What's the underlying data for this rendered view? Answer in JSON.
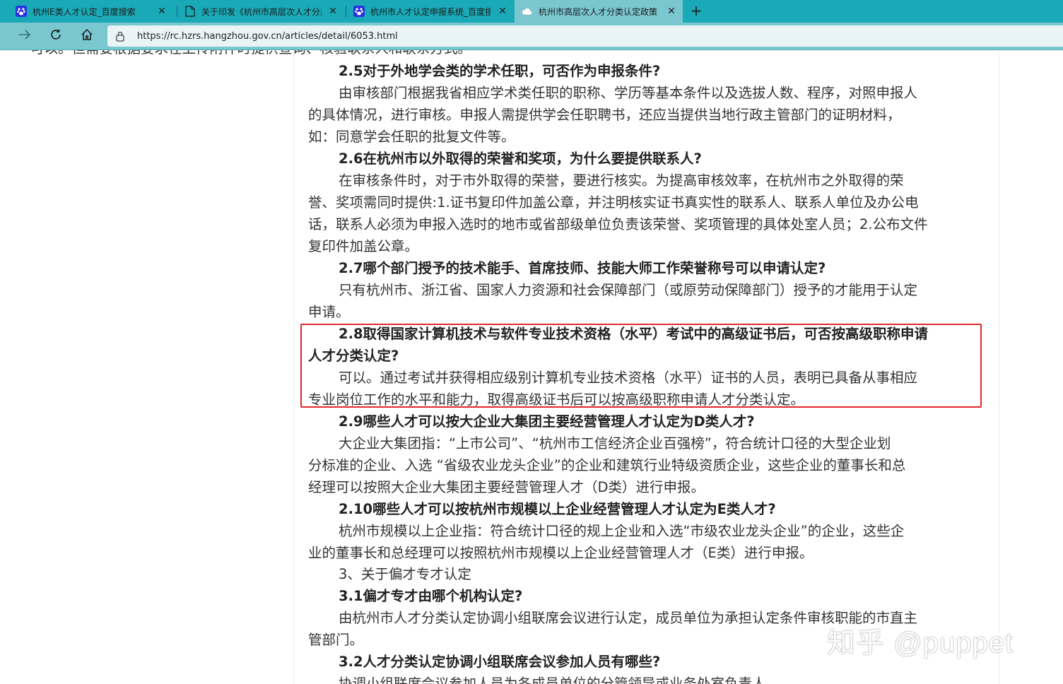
{
  "browser": {
    "tabs": [
      {
        "title": "杭州E类人才认定_百度搜索",
        "icon": "baidu-paw-icon",
        "active": false
      },
      {
        "title": "关于印发《杭州市高层次人才分类",
        "icon": "document-icon",
        "active": false
      },
      {
        "title": "杭州市人才认定申报系统_百度搜",
        "icon": "baidu-paw-icon",
        "active": false
      },
      {
        "title": "杭州市高层次人才分类认定政策",
        "icon": "loading-cloud-icon",
        "active": true
      }
    ],
    "close_glyph": "✕",
    "new_tab_glyph": "+",
    "url": "https://rc.hzrs.hangzhou.gov.cn/articles/detail/6053.html",
    "colors": {
      "tabstrip": "#1aa9b7",
      "toolbar": "#7ac7d0",
      "highlight_box": "#e0282e"
    }
  },
  "article": {
    "cut_top": "可以。但需要根据要求在上传附件时提供查询、核验联系人和联系方式。",
    "lines": [
      "2.5对于外地学会类的学术任职，可否作为申报条件?",
      "由审核部门根据我省相应学术类任职的职称、学历等基本条件以及选拔人数、程序，对照申报人",
      "的具体情况，进行审核。申报人需提供学会任职聘书，还应当提供当地行政主管部门的证明材料，",
      "如：同意学会任职的批复文件等。",
      "2.6在杭州市以外取得的荣誉和奖项，为什么要提供联系人?",
      "在审核条件时，对于市外取得的荣誉，要进行核实。为提高审核效率，在杭州市之外取得的荣",
      "誉、奖项需同时提供:1.证书复印件加盖公章，并注明核实证书真实性的联系人、联系人单位及办公电",
      "话，联系人必须为申报入选时的地市或省部级单位负责该荣誉、奖项管理的具体处室人员；2.公布文件",
      "复印件加盖公章。",
      "2.7哪个部门授予的技术能手、首席技师、技能大师工作荣誉称号可以申请认定?",
      "只有杭州市、浙江省、国家人力资源和社会保障部门（或原劳动保障部门）授予的才能用于认定",
      "申请。",
      "2.8取得国家计算机技术与软件专业技术资格（水平）考试中的高级证书后，可否按高级职称申请",
      "人才分类认定?",
      "可以。通过考试并获得相应级别计算机专业技术资格（水平）证书的人员，表明已具备从事相应",
      "专业岗位工作的水平和能力，取得高级证书后可以按高级职称申请人才分类认定。",
      "2.9哪些人才可以按大企业大集团主要经营管理人才认定为D类人才?",
      "大企业大集团指：“上市公司”、“杭州市工信经济企业百强榜”，符合统计口径的大型企业划",
      "分标准的企业、入选 “省级农业龙头企业”的企业和建筑行业特级资质企业，这些企业的董事长和总",
      "经理可以按照大企业大集团主要经营管理人才（D类）进行申报。",
      "2.10哪些人才可以按杭州市规模以上企业经营管理人才认定为E类人才?",
      "杭州市规模以上企业指：符合统计口径的规上企业和入选“市级农业龙头企业”的企业，这些企",
      "业的董事长和总经理可以按照杭州市规模以上企业经营管理人才（E类）进行申报。",
      "3、关于偏才专才认定",
      "3.1偏才专才由哪个机构认定?",
      "由杭州市人才分类认定协调小组联席会议进行认定，成员单位为承担认定条件审核职能的市直主",
      "管部门。",
      "3.2人才分类认定协调小组联席会议参加人员有哪些?",
      "协调小组联席会议参加人员为各成员单位的分管领导或业务处室负责人。"
    ]
  },
  "watermark": "知乎 @puppet"
}
